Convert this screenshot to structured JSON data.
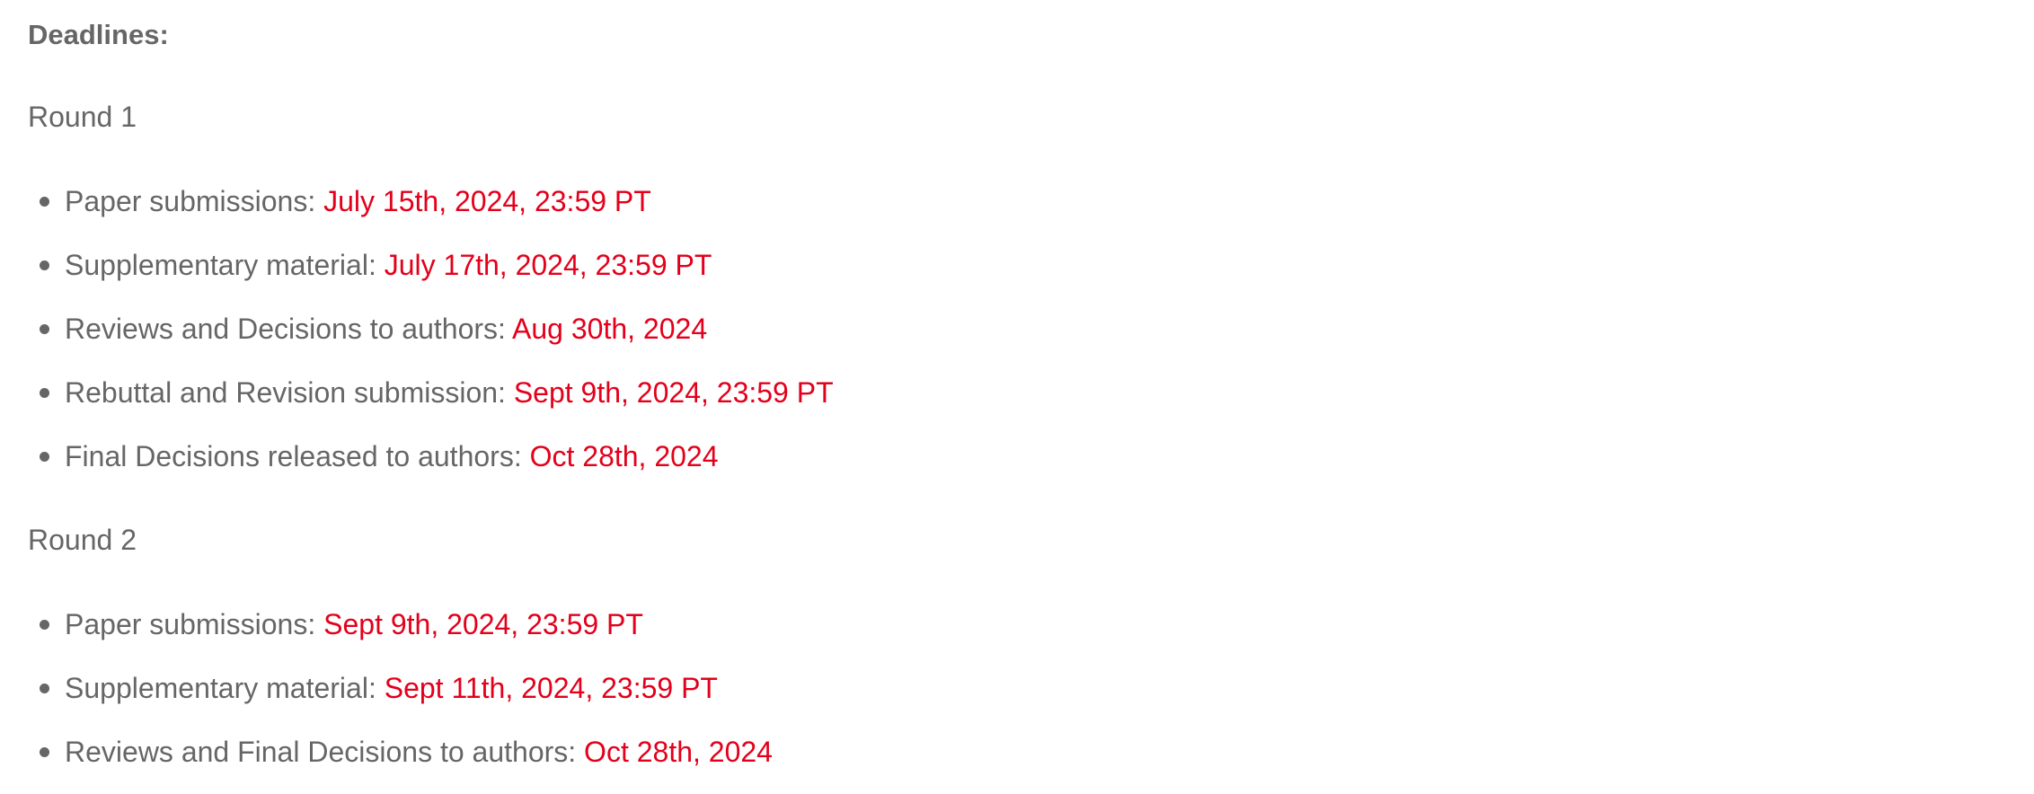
{
  "heading": "Deadlines:",
  "rounds": [
    {
      "label": "Round 1",
      "items": [
        {
          "label": "Paper submissions:",
          "date": "July 15th, 2024, 23:59 PT"
        },
        {
          "label": "Supplementary material:",
          "date": "July 17th, 2024, 23:59 PT"
        },
        {
          "label": "Reviews and Decisions to authors:",
          "date": "Aug 30th, 2024"
        },
        {
          "label": "Rebuttal and Revision submission:",
          "date": "Sept 9th, 2024, 23:59 PT"
        },
        {
          "label": "Final Decisions released to authors:",
          "date": "Oct 28th, 2024"
        }
      ]
    },
    {
      "label": "Round 2",
      "items": [
        {
          "label": "Paper submissions:",
          "date": "Sept 9th, 2024, 23:59 PT"
        },
        {
          "label": "Supplementary material:",
          "date": "Sept 11th, 2024, 23:59 PT"
        },
        {
          "label": "Reviews and Final Decisions to authors:",
          "date": "Oct 28th, 2024"
        }
      ]
    }
  ],
  "colors": {
    "text": "#666666",
    "date": "#e3001b"
  }
}
